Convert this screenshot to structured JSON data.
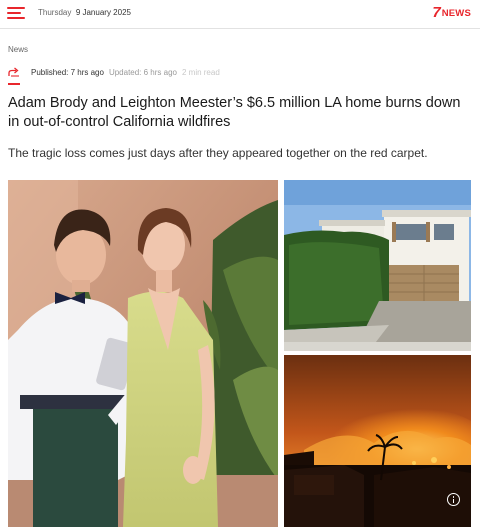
{
  "header": {
    "menu_icon": "hamburger-menu-icon",
    "date_weekday": "Thursday",
    "date_rest": "9 January 2025",
    "logo_number": "7",
    "logo_text": "NEWS",
    "brand_color": "#e8262c"
  },
  "article": {
    "category": "News",
    "share_icon": "share-arrow-icon",
    "published": "Published: 7 hrs ago",
    "updated": "Updated: 6 hrs ago",
    "read_time": "2 min read",
    "headline": "Adam Brody and Leighton Meester’s $6.5 million LA home burns down in out-of-control California wildfires",
    "standfirst": "The tragic loss comes just days after they appeared together on the red carpet."
  },
  "gallery": {
    "images": [
      {
        "subject": "couple-on-red-carpet"
      },
      {
        "subject": "white-house-behind-hedge"
      },
      {
        "subject": "wildfire-burning-homes"
      }
    ],
    "info_icon": "info-icon"
  }
}
